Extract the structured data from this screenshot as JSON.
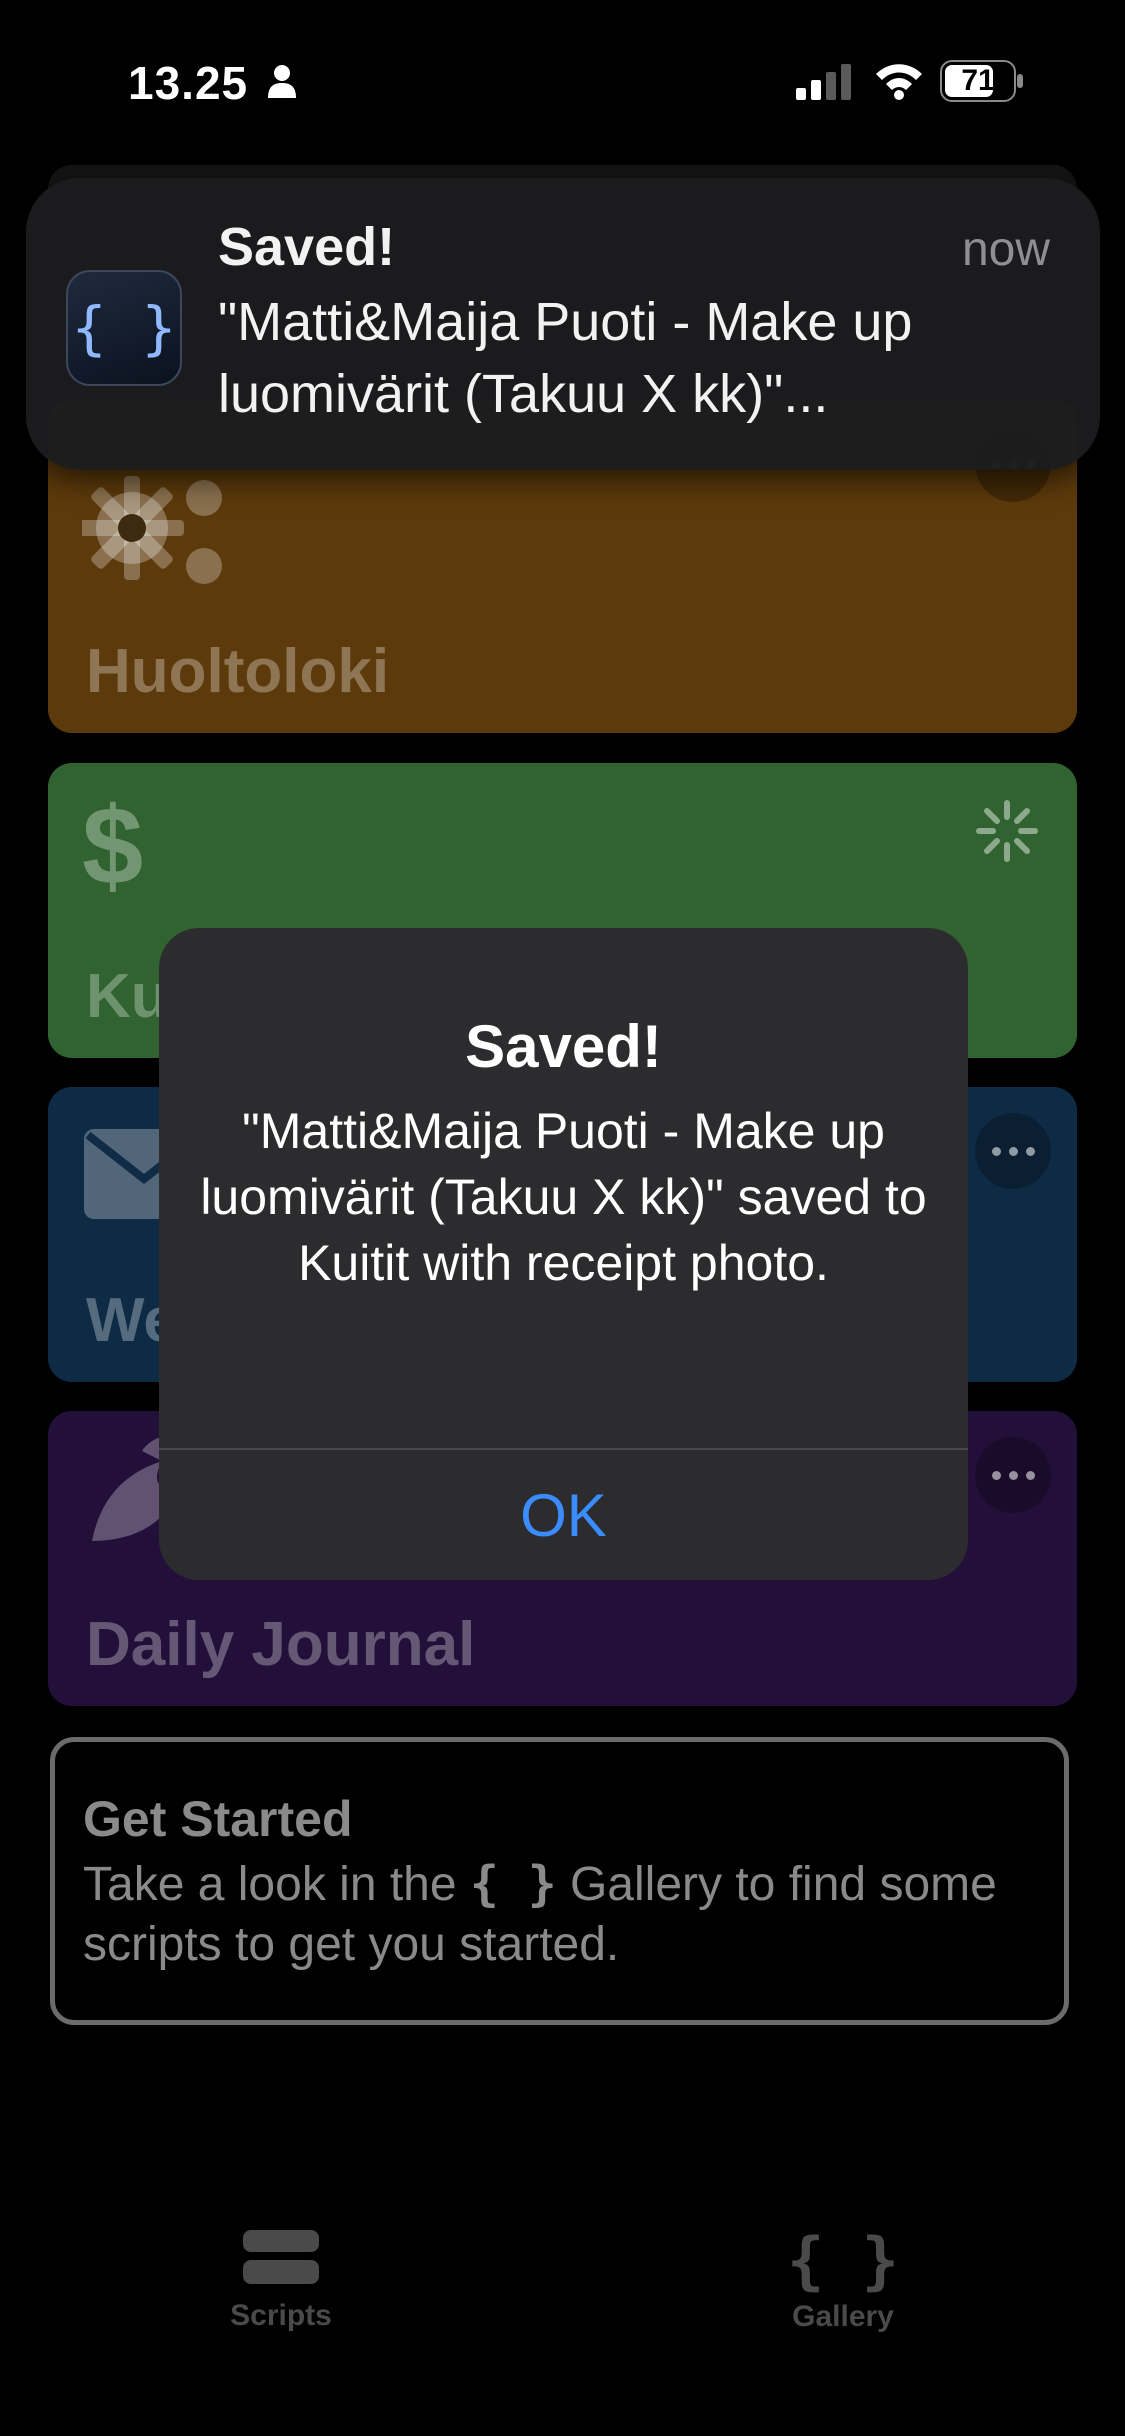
{
  "status_bar": {
    "time": "13.25",
    "battery": "71"
  },
  "cards": [
    {
      "title": "Huoltoloki",
      "icon": "gears-icon",
      "color": "#c37a17"
    },
    {
      "title": "Kuitit",
      "icon": "dollar-icon",
      "color": "#4ea04e"
    },
    {
      "title": "Web",
      "icon": "envelope-icon",
      "color": "#1f5a93"
    },
    {
      "title": "Daily Journal",
      "icon": "bird-icon",
      "color": "#49237a"
    }
  ],
  "get_started": {
    "title": "Get Started",
    "text_before": "Take a look in the",
    "icon_glyph": "{ }",
    "text_after": "Gallery to find some scripts to get you started."
  },
  "tabs": [
    {
      "label": "Scripts",
      "icon": "stack-icon"
    },
    {
      "label": "Gallery",
      "icon": "braces-icon",
      "icon_glyph": "{ }"
    }
  ],
  "notification": {
    "app_icon_glyph": "{ }",
    "title": "Saved!",
    "time": "now",
    "body": "\"Matti&Maija Puoti - Make up luomivärit (Takuu X kk)\"..."
  },
  "alert": {
    "title": "Saved!",
    "message": "\"Matti&Maija Puoti - Make up luomivärit (Takuu X kk)\" saved to Kuitit with receipt photo.",
    "ok_label": "OK"
  },
  "colors": {
    "accent": "#3b8cff",
    "background": "#000000"
  }
}
